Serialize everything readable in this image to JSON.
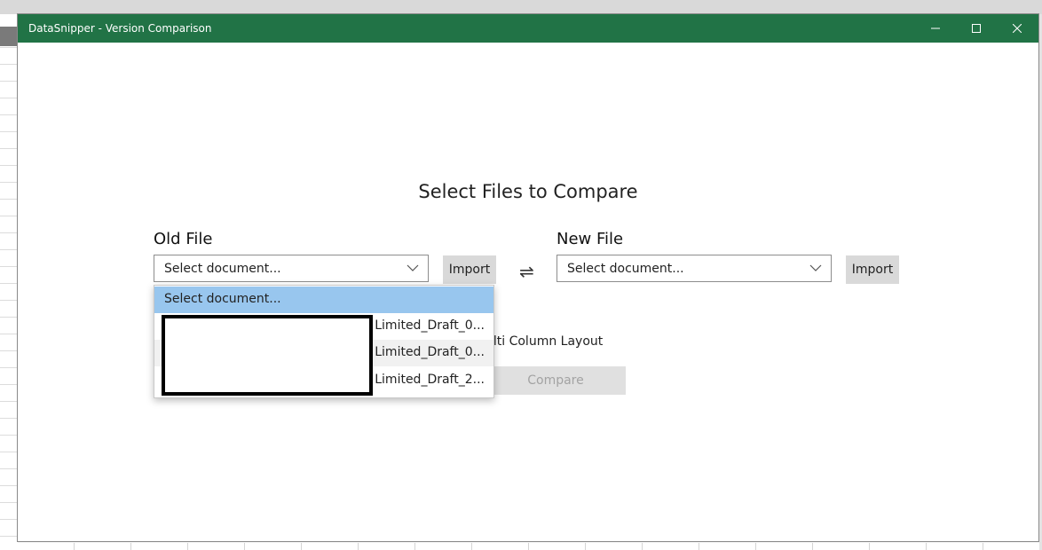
{
  "window": {
    "title": "DataSnipper - Version Comparison",
    "controls": {
      "minimize": "—",
      "maximize": "☐",
      "close": "✕"
    }
  },
  "main": {
    "heading": "Select Files to Compare",
    "old_file": {
      "label": "Old File",
      "selected": "Select document...",
      "import_label": "Import"
    },
    "new_file": {
      "label": "New File",
      "selected": "Select document...",
      "import_label": "Import"
    },
    "swap_icon": "⇌",
    "multi_column_label": "ulti Column Layout",
    "compare_label": "Compare"
  },
  "dropdown": {
    "items": [
      "Select document...",
      "ent Limited_Draft_0...",
      "ent Limited_Draft_0...",
      "ent Limited_Draft_2..."
    ]
  },
  "icons": {
    "chevron": "chevron-down-icon",
    "swap": "swap-arrows-icon"
  },
  "colors": {
    "titlebar": "#217346",
    "selected_item": "#98c6ee",
    "button": "#d9d9d9"
  }
}
